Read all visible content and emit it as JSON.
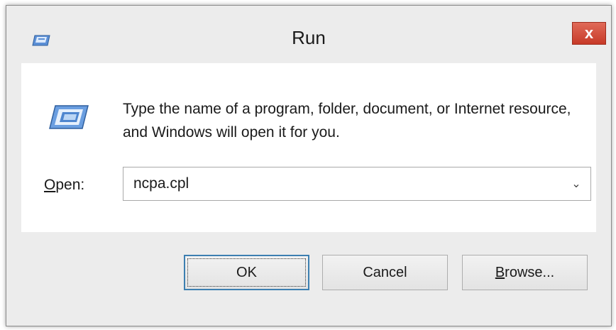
{
  "window": {
    "title": "Run",
    "close_glyph": "x",
    "icon": "run-icon",
    "colors": {
      "close_button": "#c73a28",
      "default_button_border": "#3c7fb1",
      "content_background": "#ffffff",
      "frame_background": "#ececec"
    }
  },
  "content": {
    "description": "Type the name of a program, folder, document, or Internet resource, and Windows will open it for you.",
    "open_label_accel": "O",
    "open_label_rest": "pen:",
    "open_value": "ncpa.cpl",
    "dropdown_glyph": "⌄"
  },
  "buttons": {
    "ok_label": "OK",
    "cancel_label": "Cancel",
    "browse_label_accel": "B",
    "browse_label_rest": "rowse..."
  }
}
